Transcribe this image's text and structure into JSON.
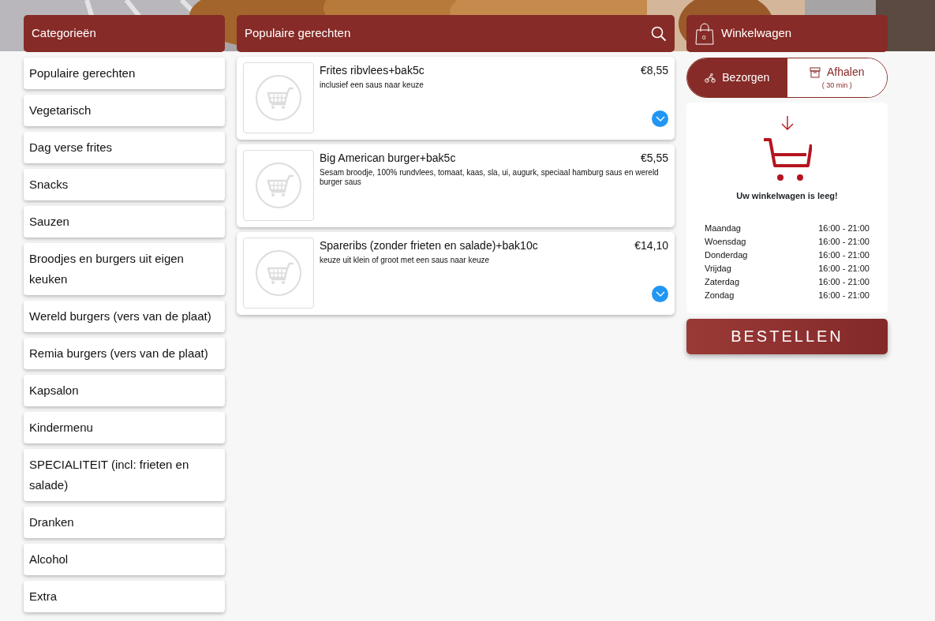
{
  "categories": {
    "title": "Categorieën",
    "items": [
      {
        "label": "Populaire gerechten"
      },
      {
        "label": "Vegetarisch"
      },
      {
        "label": "Dag verse frites"
      },
      {
        "label": "Snacks"
      },
      {
        "label": "Sauzen"
      },
      {
        "label": "Broodjes en burgers uit eigen keuken"
      },
      {
        "label": "Wereld burgers (vers van de plaat)"
      },
      {
        "label": "Remia burgers (vers van de plaat)"
      },
      {
        "label": "Kapsalon"
      },
      {
        "label": "Kindermenu"
      },
      {
        "label": "SPECIALITEIT (incl: frieten en salade)"
      },
      {
        "label": "Dranken"
      },
      {
        "label": "Alcohol"
      },
      {
        "label": "Extra"
      }
    ]
  },
  "dishes": {
    "title": "Populaire gerechten",
    "items": [
      {
        "name": "Frites ribvlees+bak5c",
        "price": "€8,55",
        "description": "inclusief een saus naar keuze",
        "expandable": true
      },
      {
        "name": "Big American burger+bak5c",
        "price": "€5,55",
        "description": "Sesam broodje, 100% rundvlees, tomaat, kaas, sla, ui, augurk, speciaal hamburg saus en wereld burger saus",
        "expandable": false
      },
      {
        "name": "Spareribs (zonder frieten en salade)+bak10c",
        "price": "€14,10",
        "description": "keuze uit klein of groot met een saus naar keuze",
        "expandable": true
      }
    ]
  },
  "cart": {
    "title": "Winkelwagen",
    "count": "0",
    "modes": [
      {
        "kind": "delivery",
        "label": "Bezorgen",
        "selected": true
      },
      {
        "kind": "pickup",
        "label": "Afhalen",
        "note": "( 30 min )",
        "selected": false
      }
    ],
    "empty_message": "Uw winkelwagen is leeg!",
    "hours": [
      {
        "day": "Maandag",
        "time": "16:00 - 21:00"
      },
      {
        "day": "Woensdag",
        "time": "16:00 - 21:00"
      },
      {
        "day": "Donderdag",
        "time": "16:00 - 21:00"
      },
      {
        "day": "Vrijdag",
        "time": "16:00 - 21:00"
      },
      {
        "day": "Zaterdag",
        "time": "16:00 - 21:00"
      },
      {
        "day": "Zondag",
        "time": "16:00 - 21:00"
      }
    ],
    "order_button": "BESTELLEN"
  }
}
